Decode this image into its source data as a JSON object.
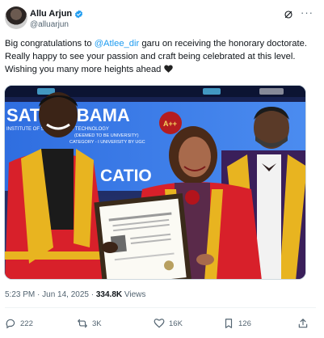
{
  "author": {
    "name": "Allu Arjun",
    "handle": "@alluarjun",
    "verified": true
  },
  "tweet": {
    "text_before": "Big congratulations to ",
    "mention": "@Atlee_dir",
    "text_after": " garu on receiving the honorary doctorate. Really happy to see your passion and craft being celebrated at this level. Wishing you many more heights ahead",
    "emoji_icon": "black-heart-icon"
  },
  "photo": {
    "banner_text": "SATHYABAMA",
    "banner_sub1": "INSTITUTE OF SCIENCE AND TECHNOLOGY",
    "banner_sub2": "(DEEMED TO BE UNIVERSITY)",
    "banner_sub3": "CATEGORY - I UNIVERSITY BY UGC",
    "banner_convocation": "CATIO",
    "naac_badge": "A++",
    "naac_text": "NA"
  },
  "meta": {
    "time": "5:23 PM",
    "separator": " · ",
    "date": "Jun 14, 2025",
    "views_count": "334.8K",
    "views_label": " Views"
  },
  "actions": {
    "replies": "222",
    "reposts": "3K",
    "likes": "16K",
    "bookmarks": "126"
  },
  "colors": {
    "link": "#1d9bf0",
    "secondary_text": "#536471",
    "gown_red": "#d8202a",
    "gown_gold": "#e8b420"
  }
}
